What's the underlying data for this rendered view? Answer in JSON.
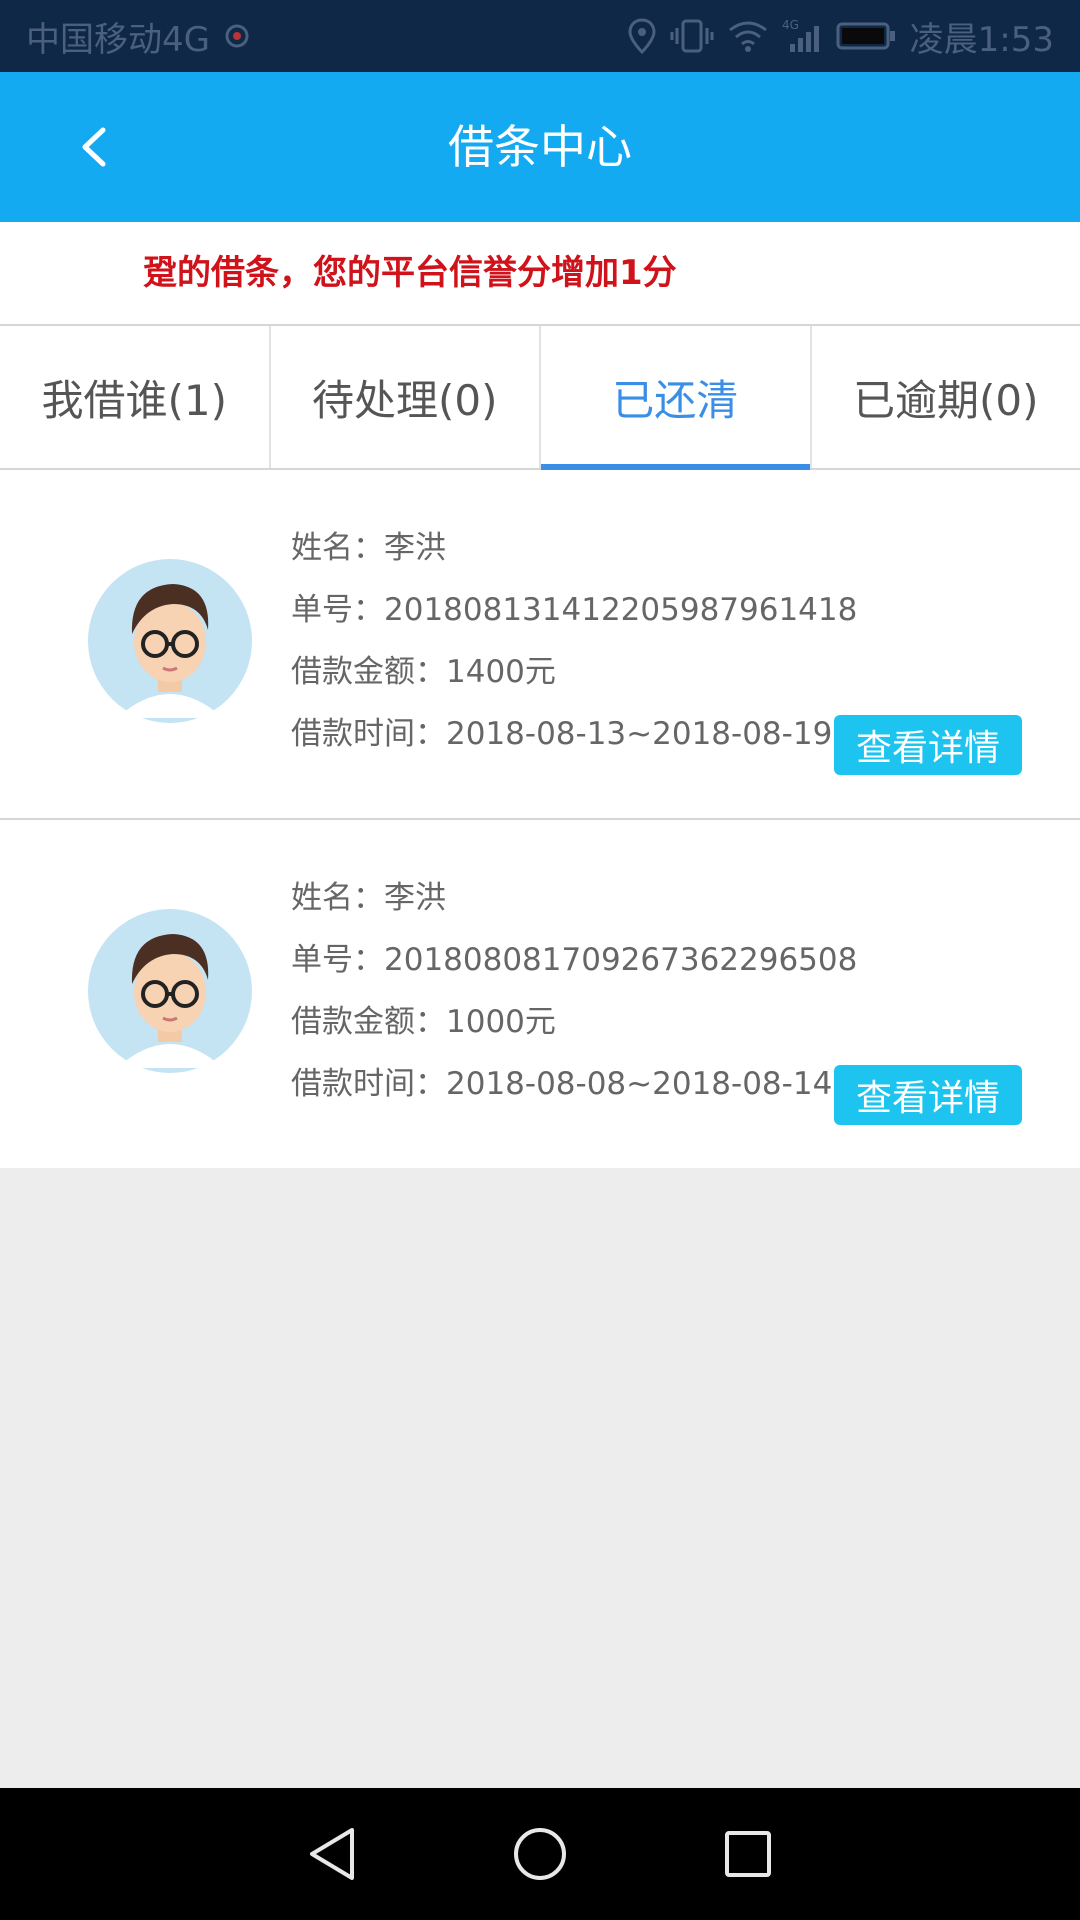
{
  "status_bar": {
    "carrier": "中国移动4G",
    "time": "凌晨1:53",
    "network_label": "4G",
    "icons": [
      "notification-icon",
      "location-icon",
      "vibrate-icon",
      "wifi-icon",
      "signal-icon",
      "battery-icon"
    ]
  },
  "app_bar": {
    "title": "借条中心",
    "back_icon": "chevron-left-icon"
  },
  "notice": {
    "text": "跫的借条，您的平台信誉分增加1分"
  },
  "tabs": [
    {
      "label": "我借谁(1)",
      "active": false
    },
    {
      "label": "待处理(0)",
      "active": false
    },
    {
      "label": "已还清",
      "active": true
    },
    {
      "label": "已逾期(0)",
      "active": false
    }
  ],
  "loans": [
    {
      "name_label": "姓名：",
      "name": "李洪",
      "order_label": "单号：",
      "order_no": "20180813141220598796141​8",
      "amount_label": "借款金额：",
      "amount": "1400元",
      "time_label": "借款时间：",
      "time": "2018-08-13~2018-08-19",
      "button": "查看详情"
    },
    {
      "name_label": "姓名：",
      "name": "李洪",
      "order_label": "单号：",
      "order_no": "2018080817092673622965​08",
      "amount_label": "借款金额：",
      "amount": "1000元",
      "time_label": "借款时间：",
      "time": "2018-08-08~2018-08-14",
      "button": "查看详情"
    }
  ],
  "nav_bar": {
    "icons": [
      "back-triangle-icon",
      "home-circle-icon",
      "recents-square-icon"
    ]
  },
  "colors": {
    "app_bar": "#13aaf2",
    "status_bar": "#0f2847",
    "accent": "#3a8ee6",
    "notice": "#d0121b",
    "button": "#1ec4f0"
  }
}
